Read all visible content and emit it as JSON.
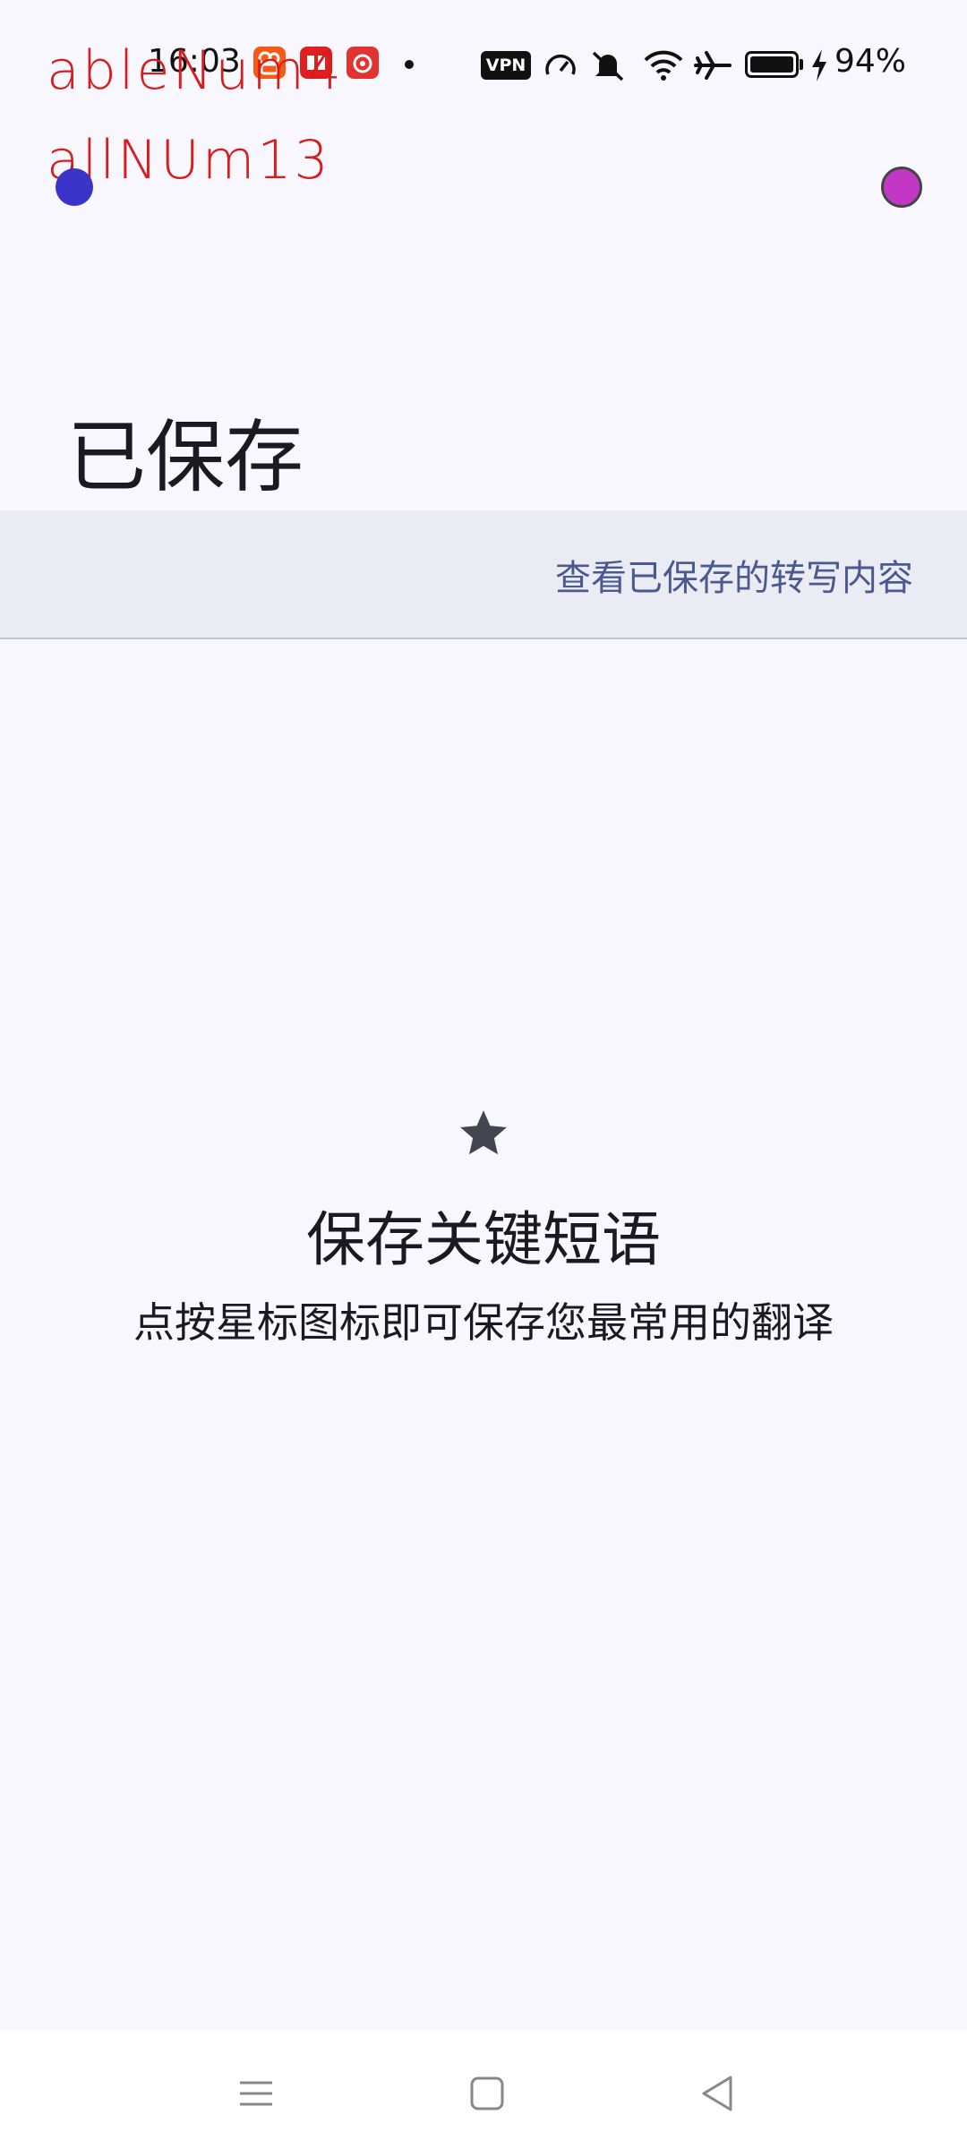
{
  "status_bar": {
    "time": "16:03",
    "vpn_label": "VPN",
    "battery_percent": "94%",
    "battery_level": 0.94,
    "icons": [
      "kuaishou-icon",
      "pinduoduo-icon",
      "netease-music-icon",
      "notification-dot-icon",
      "speed-icon",
      "mute-icon",
      "wifi-icon",
      "airplane-icon",
      "battery-icon",
      "charging-icon"
    ]
  },
  "overlay": {
    "line1": "ableNum4",
    "line2": "allNUm13"
  },
  "header": {
    "title": "已保存"
  },
  "subheader": {
    "link_text": "查看已保存的转写内容"
  },
  "empty_state": {
    "icon": "star-icon",
    "heading": "保存关键短语",
    "description": "点按星标图标即可保存您最常用的翻译"
  },
  "navigation": {
    "buttons": [
      "menu-icon",
      "home-icon",
      "back-icon"
    ]
  },
  "colors": {
    "background": "#f8f7fd",
    "subheader_bg": "#ebebf3",
    "link": "#4a5a90",
    "overlay_text": "#d81b1b",
    "overlay_dot_blue": "#3a35c8",
    "overlay_dot_magenta": "#c238c4"
  }
}
